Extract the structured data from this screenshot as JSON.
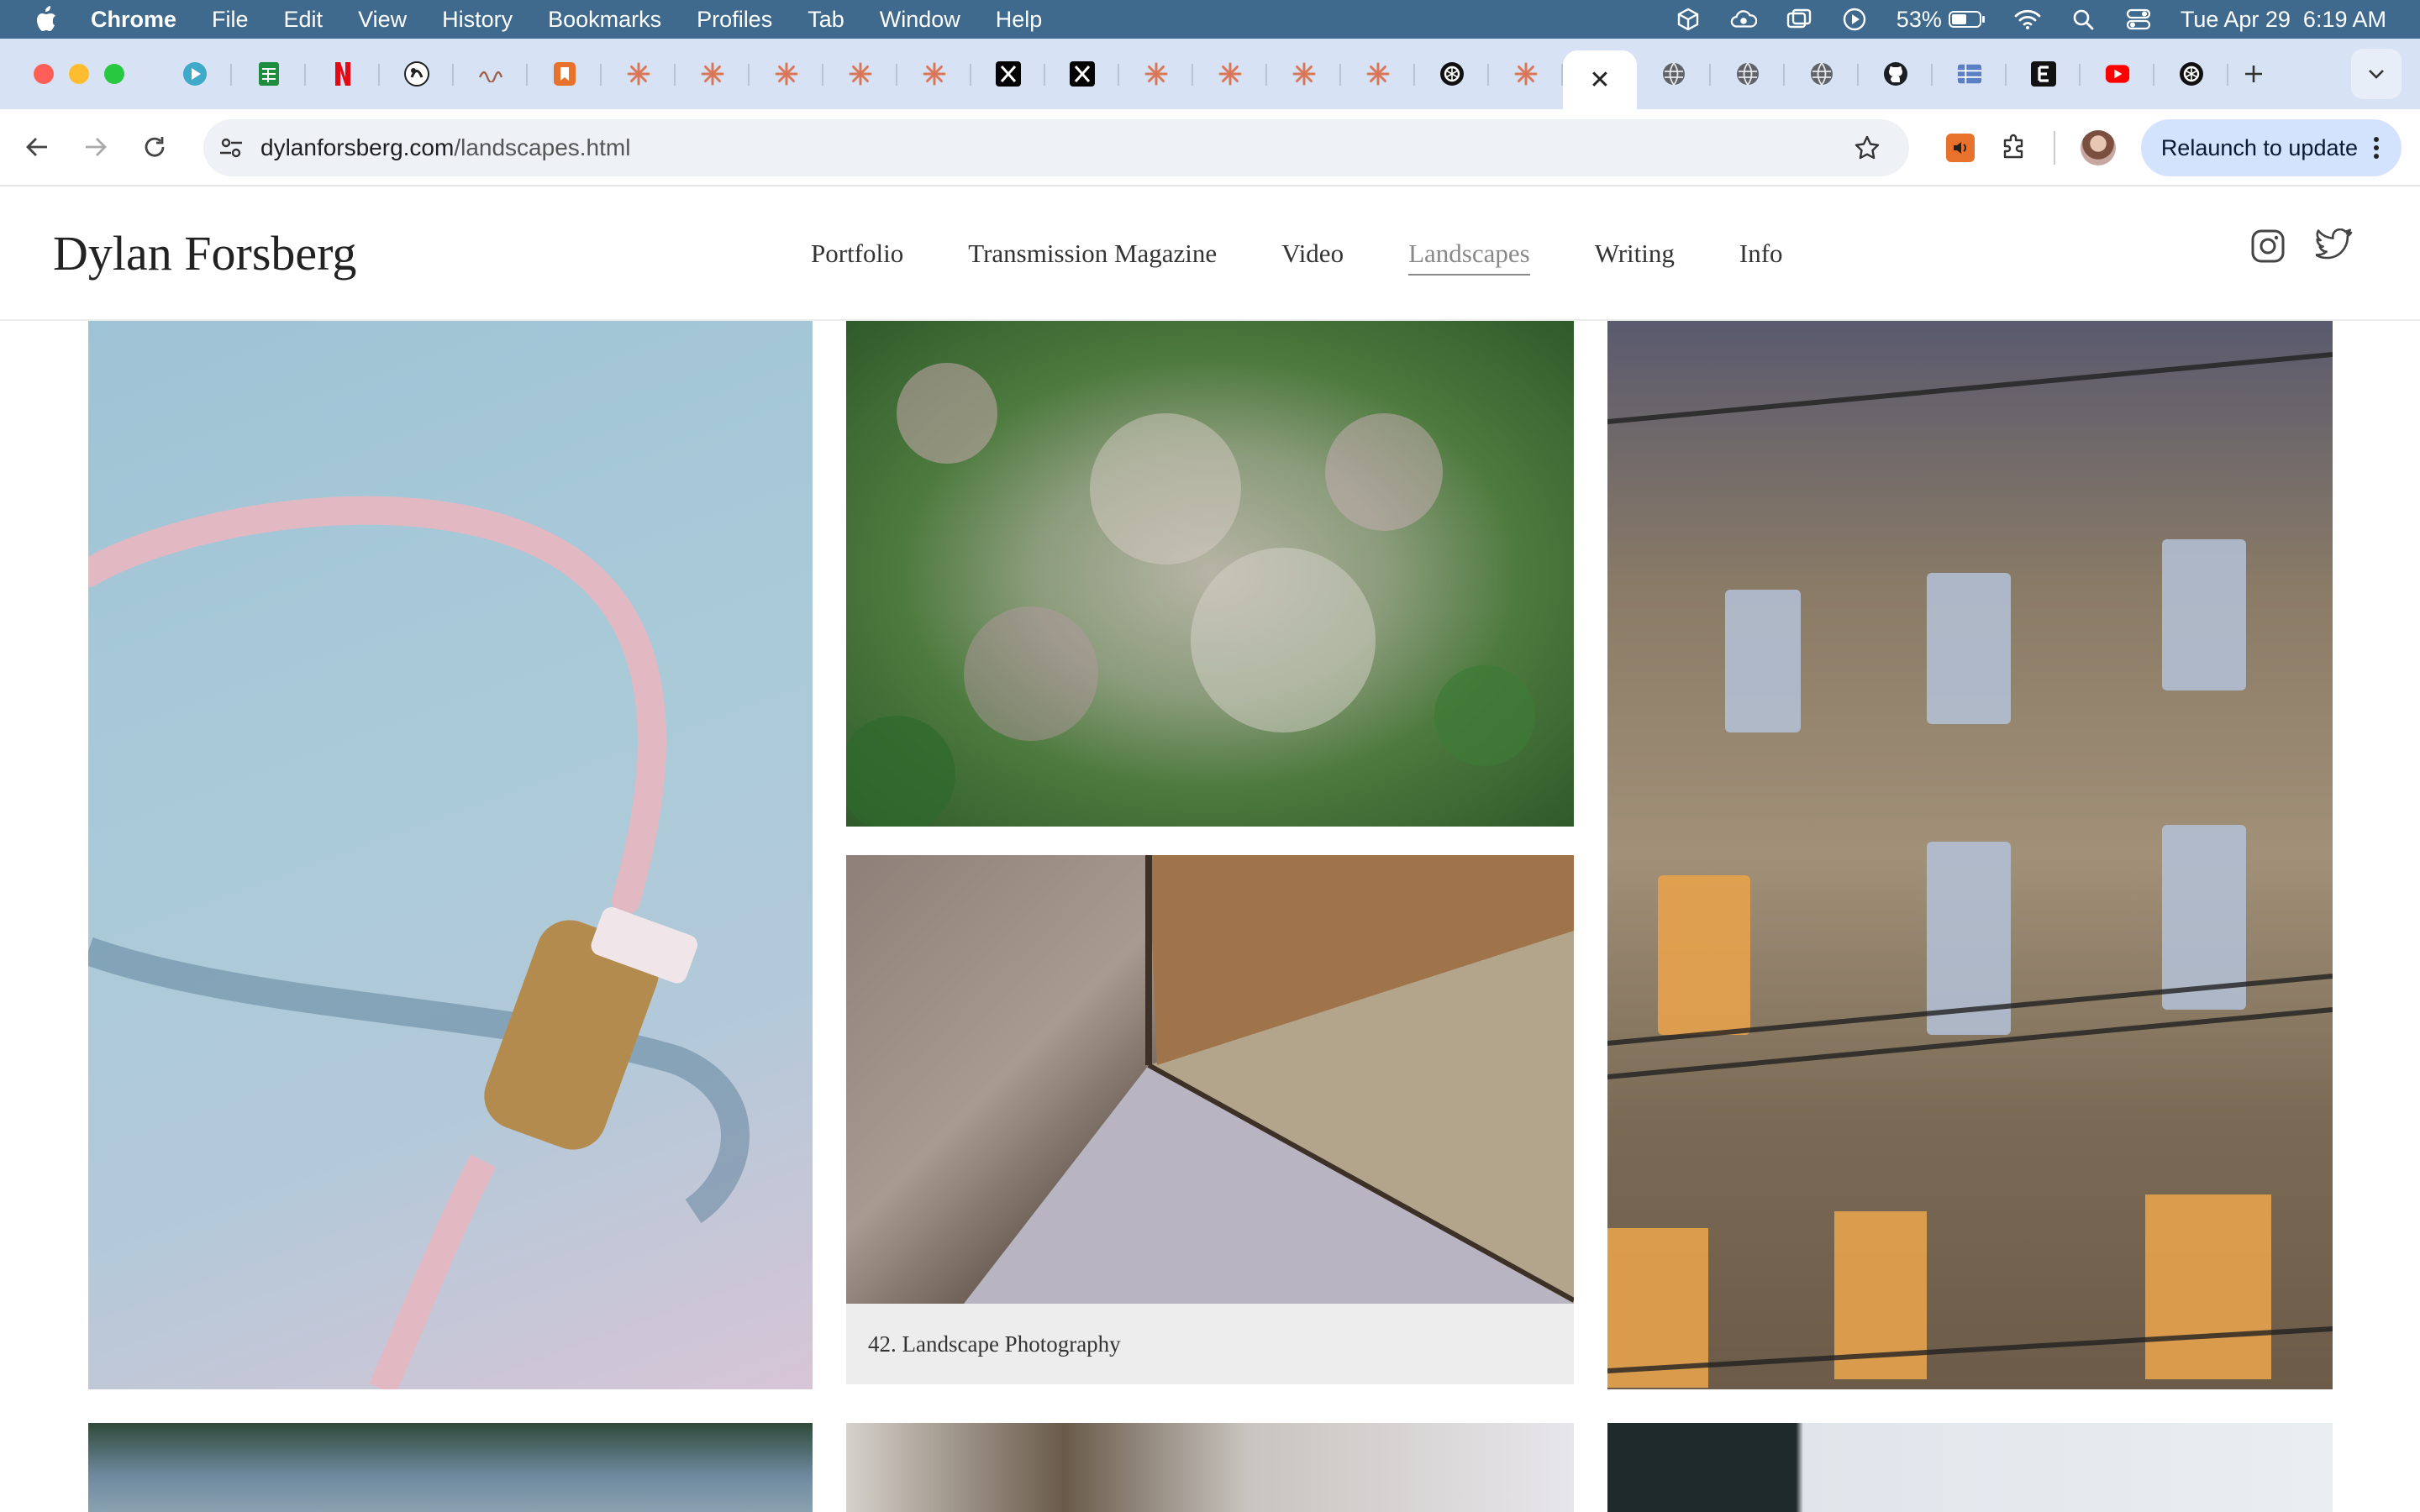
{
  "menubar": {
    "app_name": "Chrome",
    "items": [
      "File",
      "Edit",
      "View",
      "History",
      "Bookmarks",
      "Profiles",
      "Tab",
      "Window",
      "Help"
    ],
    "battery": "53%",
    "datetime": "Tue Apr 29  6:19 AM"
  },
  "tabs": {
    "favicons": [
      "play-icon",
      "sheets-icon",
      "netflix-icon",
      "ai-icon",
      "wave-icon",
      "bookmark-icon",
      "claude-icon",
      "claude-icon",
      "claude-icon",
      "claude-icon",
      "claude-icon",
      "x-icon",
      "x-icon",
      "claude-icon",
      "claude-icon",
      "claude-icon",
      "claude-icon",
      "openai-icon",
      "claude-icon",
      "active-tab-close",
      "globe-icon",
      "globe-icon",
      "globe-icon",
      "github-icon",
      "panel-icon",
      "e-icon",
      "youtube-icon",
      "openai-icon"
    ],
    "active_close_glyph": "✕"
  },
  "toolbar": {
    "url_domain": "dylanforsberg.com",
    "url_path": "/landscapes.html",
    "relaunch_label": "Relaunch to update"
  },
  "site": {
    "title": "Dylan Forsberg",
    "nav": [
      "Portfolio",
      "Transmission Magazine",
      "Video",
      "Landscapes",
      "Writing",
      "Info"
    ],
    "active_nav": "Landscapes"
  },
  "gallery": {
    "caption": "42. Landscape Photography"
  },
  "colors": {
    "menubar_bg": "#3f6a8e",
    "tabstrip_bg": "#d7e3f4",
    "relaunch_bg": "#d3e3fd",
    "claude_accent": "#d97757"
  }
}
